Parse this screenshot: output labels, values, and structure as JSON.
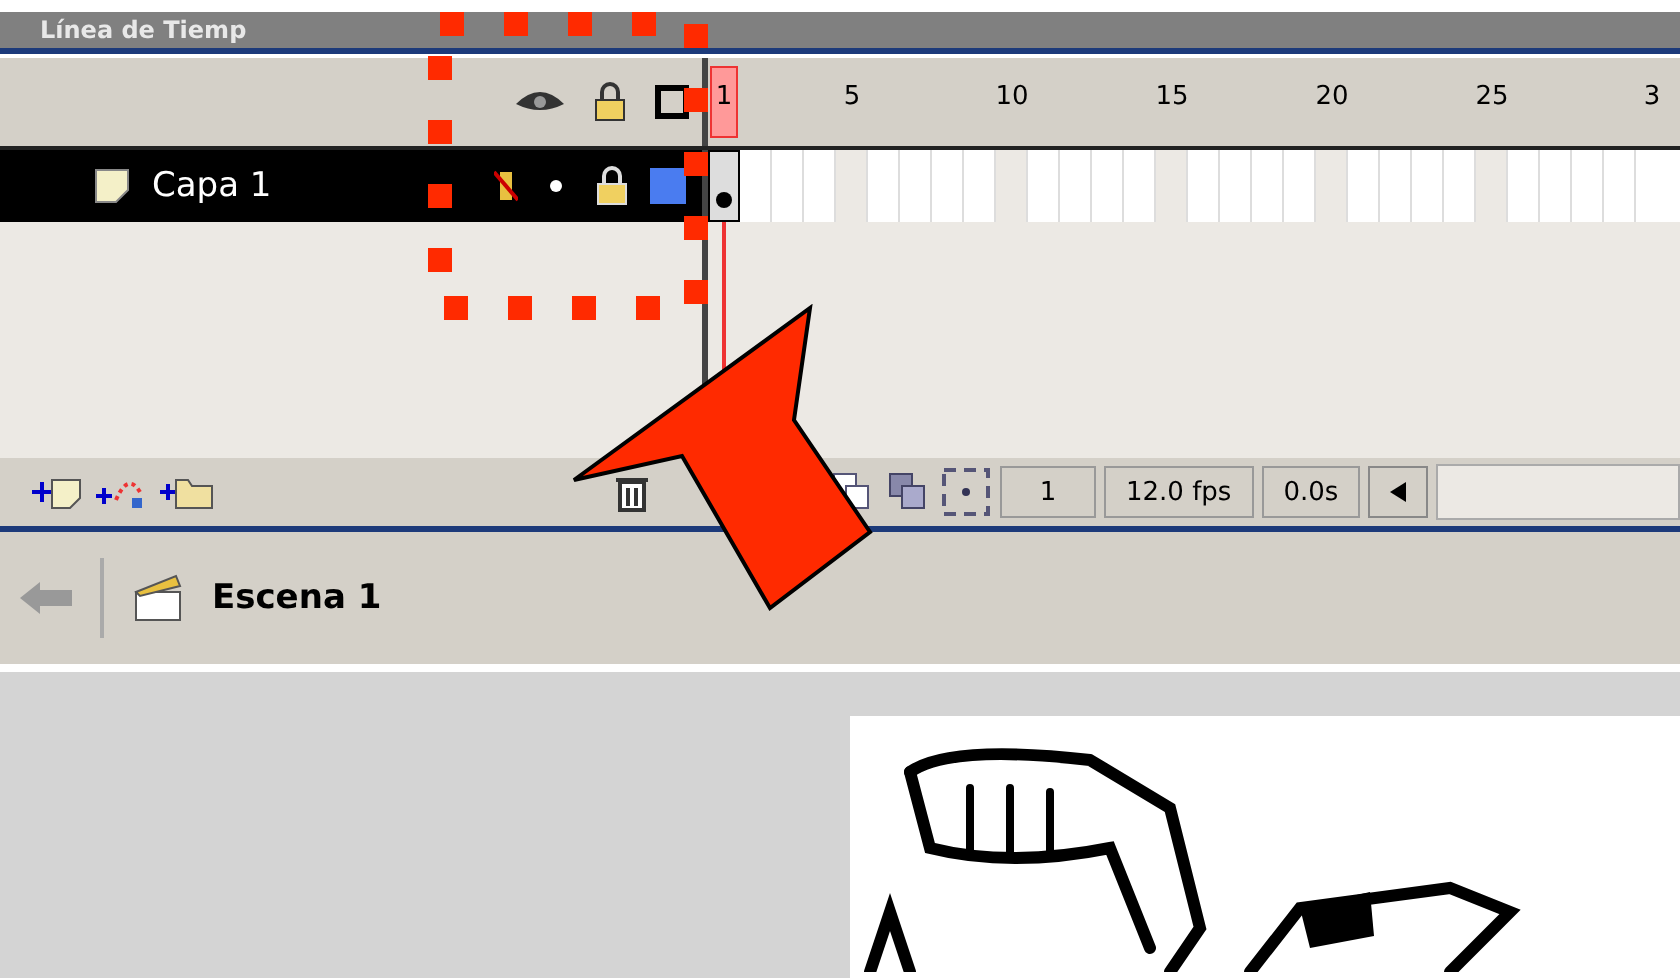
{
  "panel": {
    "title": "Línea de Tiemp"
  },
  "ruler": {
    "labels": [
      "1",
      "5",
      "10",
      "15",
      "20",
      "25",
      "3"
    ]
  },
  "layers": [
    {
      "name": "Capa 1",
      "selected": true,
      "visible": true,
      "locked": true,
      "color": "#4a7cf0",
      "keyframe": true
    }
  ],
  "status": {
    "current_frame": "1",
    "frame_rate": "12.0 fps",
    "elapsed": "0.0s"
  },
  "scene": {
    "name": "Escena 1"
  }
}
